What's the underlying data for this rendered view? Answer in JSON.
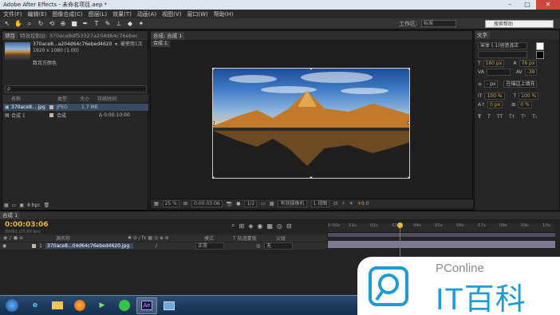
{
  "app": {
    "title": "Adobe After Effects - 未命名项目.aep *",
    "menu": [
      "文件(F)",
      "编辑(E)",
      "图像合成(C)",
      "图层(L)",
      "效果(T)",
      "动画(A)",
      "视图(V)",
      "窗口(W)",
      "帮助(H)"
    ],
    "workspace_label": "工作区:",
    "workspace_value": "标准",
    "search_help_placeholder": "搜索帮助"
  },
  "project_panel": {
    "tab_project": "项目",
    "tab_effects": "特效控制台: 370ace8df53327a204d64c76ebed46",
    "item_name": "370ace8...a204d64c76ebed4620.jpg",
    "item_used": "▾, 被使用1次",
    "item_dims": "1920 x 1080 (1.00)",
    "item_color": "数百万颜色",
    "search_placeholder": "ρ",
    "columns": [
      "名称",
      "类型",
      "大小",
      "持续时间"
    ],
    "rows": [
      {
        "name": "370ace8....jpg",
        "type": "JPEG",
        "size": "1.7 MB",
        "duration": ""
      },
      {
        "name": "合成 1",
        "type": "合成",
        "size": "",
        "duration": "Δ 0:00:10:00"
      }
    ],
    "bpc": "8 bpc"
  },
  "composition": {
    "tab": "合成: 合成 1",
    "sub_tab": "合成 1",
    "zoom": "25 %",
    "timecode": "0:00:03:06",
    "resolution": "1/2",
    "camera": "有效摄像机",
    "view": "1 视图",
    "exposure": "+0.0"
  },
  "character_panel": {
    "title": "文字",
    "font": "宋体 (-1)创意品正",
    "style": "",
    "size": "160 px",
    "leading": "76 px",
    "kerning": "VA",
    "tracking": "-39",
    "stroke_width": "- px",
    "stroke_mode": "在描边上填充",
    "vscale": "100 %",
    "hscale": "100 %",
    "baseline": "0 px",
    "tsume": "0 %",
    "style_buttons": [
      "T",
      "T",
      "TT",
      "Tт",
      "T¹",
      "T₁"
    ]
  },
  "timeline": {
    "tab": "合成 1",
    "timecode": "0:00:03:06",
    "frame_hint": "00081 (25.00 fps)",
    "col_source": "源名称",
    "col_mode": "模式",
    "col_trkmat": "T  轨道蒙板",
    "col_parent": "父级",
    "layer_num": "1",
    "layer_name": "370ace8...04d64c76ebed4620.jpg",
    "layer_mode": "正常",
    "layer_parent": "无",
    "ticks": [
      "0:00s",
      "01s",
      "02s",
      "03s",
      "04s",
      "05s",
      "06s",
      "07s",
      "08s",
      "09s",
      "10s"
    ]
  },
  "taskbar": {
    "apps": [
      "start-icon",
      "ie-icon",
      "explorer-icon",
      "firefox-icon",
      "media-player-icon",
      "360-icon",
      "after-effects-icon",
      "window-icon"
    ],
    "ae_label": "Ae"
  },
  "watermark": {
    "brand": "PConline",
    "text": "IT百科",
    "bg": "#ffffff",
    "accent": "#1e9bd7"
  }
}
